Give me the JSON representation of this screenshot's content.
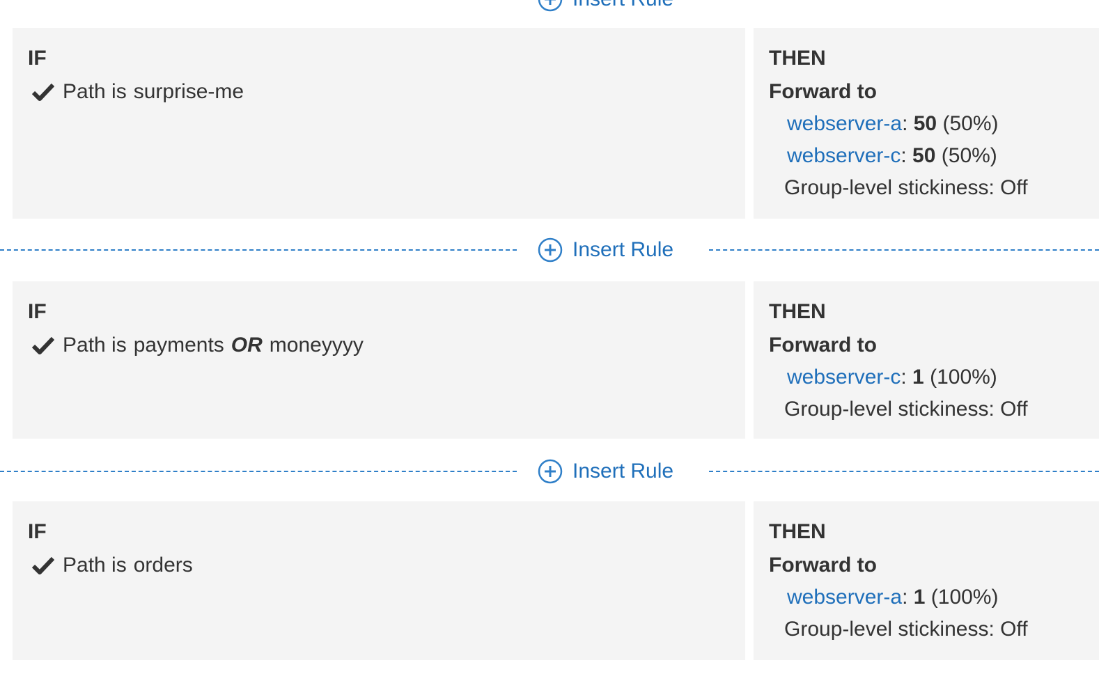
{
  "insert_label": "Insert Rule",
  "labels": {
    "if": "IF",
    "then": "THEN",
    "forward_to": "Forward to",
    "path_is": "Path is",
    "or": "OR",
    "stickiness": "Group-level stickiness: Off"
  },
  "rules": [
    {
      "condition_values": [
        "surprise-me"
      ],
      "targets": [
        {
          "name": "webserver-a",
          "weight": "50",
          "percent": "(50%)"
        },
        {
          "name": "webserver-c",
          "weight": "50",
          "percent": "(50%)"
        }
      ]
    },
    {
      "condition_values": [
        "payments",
        "moneyyyy"
      ],
      "targets": [
        {
          "name": "webserver-c",
          "weight": "1",
          "percent": "(100%)"
        }
      ]
    },
    {
      "condition_values": [
        "orders"
      ],
      "targets": [
        {
          "name": "webserver-a",
          "weight": "1",
          "percent": "(100%)"
        }
      ]
    }
  ],
  "colors": {
    "link": "#1f6fba",
    "panel_bg": "#f4f4f4",
    "text": "#333333"
  },
  "icons": {
    "insert": "plus-circle-icon",
    "condition": "check-icon"
  }
}
